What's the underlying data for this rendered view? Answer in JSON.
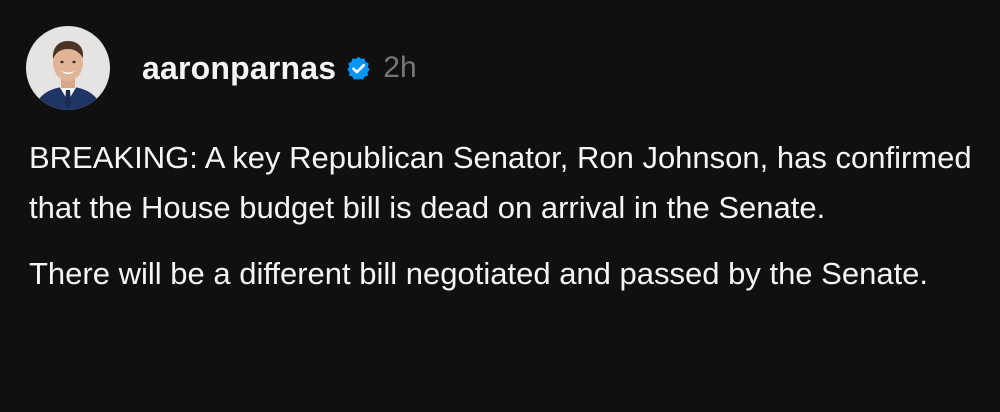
{
  "post": {
    "author": {
      "username": "aaronparnas",
      "verified_icon": "verified-badge-icon",
      "timestamp": "2h"
    },
    "paragraphs": [
      "BREAKING: A key Republican Senator, Ron Johnson, has confirmed that the House budget bill is dead on arrival in the Senate.",
      "There will be a different bill negotiated and passed by the Senate."
    ]
  },
  "colors": {
    "background": "#101010",
    "text": "#f3f5f7",
    "muted": "#777777",
    "verified_blue": "#0095f6"
  }
}
